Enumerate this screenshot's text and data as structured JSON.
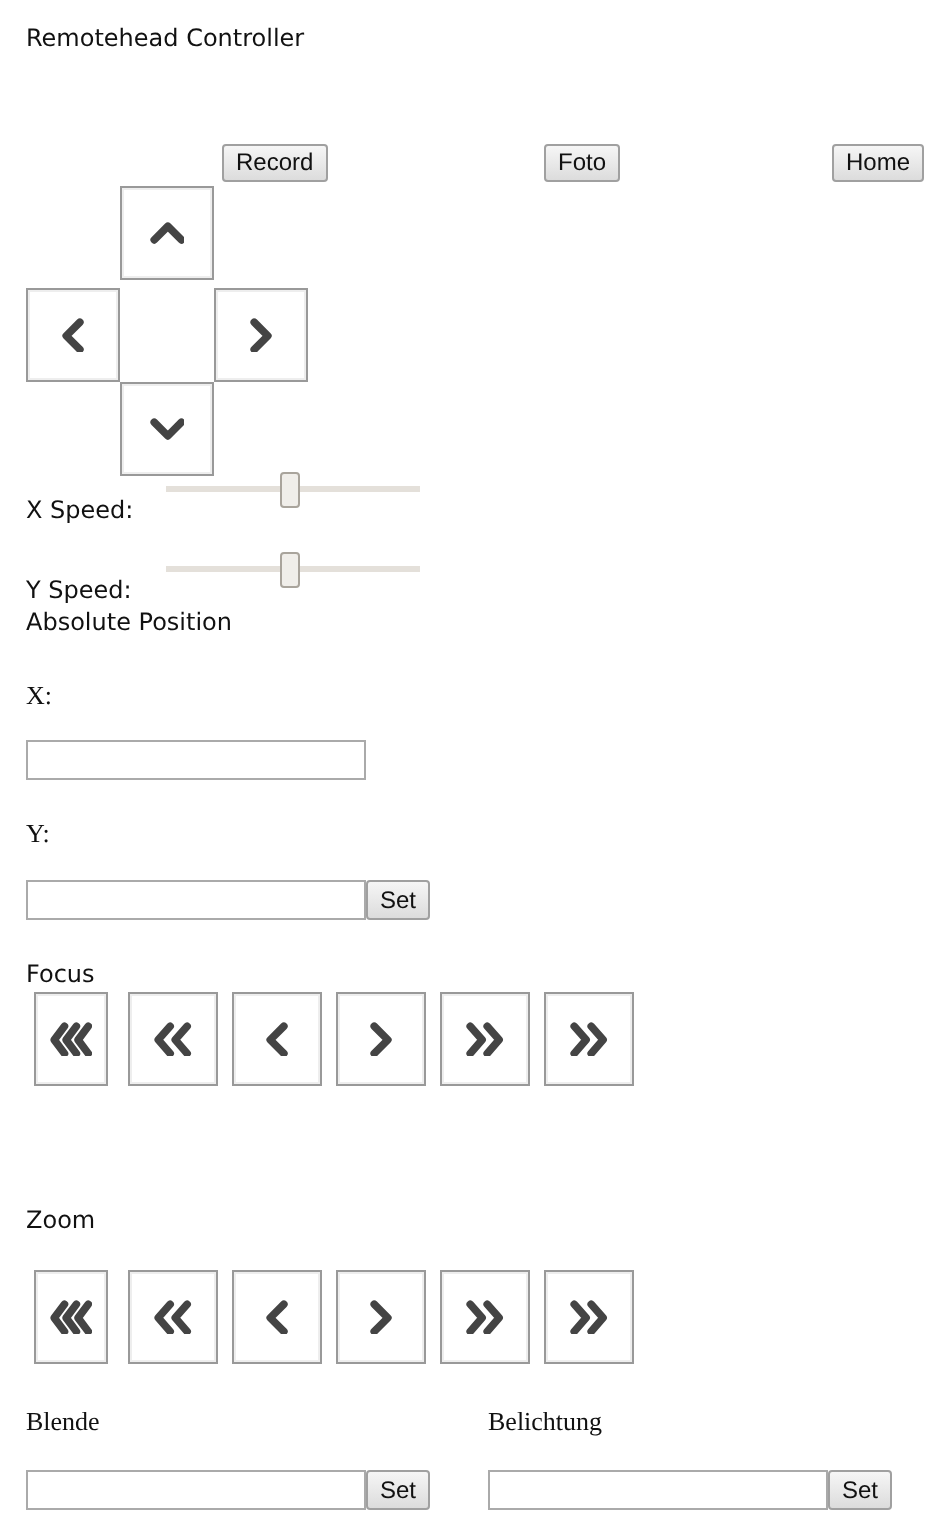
{
  "title": "Remotehead Controller",
  "top_buttons": [
    {
      "label": "Record"
    },
    {
      "label": "Foto"
    },
    {
      "label": "Home"
    }
  ],
  "dpad": [
    {
      "kind": "up"
    },
    {
      "kind": "left"
    },
    {
      "kind": "right"
    },
    {
      "kind": "down"
    }
  ],
  "speeds": [
    {
      "label": "X Speed:",
      "level": 0.49
    },
    {
      "label": "Y Speed:",
      "level": 0.49
    }
  ],
  "absolute_position": {
    "heading": "Absolute Position",
    "x_label": "X:",
    "y_label": "Y:",
    "set_button": "Set"
  },
  "focus": {
    "heading": "Focus",
    "buttons": [
      {
        "kind": "triple-left"
      },
      {
        "kind": "double-left"
      },
      {
        "kind": "left"
      },
      {
        "kind": "right"
      },
      {
        "kind": "double-right"
      },
      {
        "kind": "double-right"
      }
    ]
  },
  "zoom": {
    "heading": "Zoom",
    "buttons": [
      {
        "kind": "triple-left"
      },
      {
        "kind": "double-left"
      },
      {
        "kind": "left"
      },
      {
        "kind": "right"
      },
      {
        "kind": "double-right"
      },
      {
        "kind": "double-right"
      }
    ]
  },
  "settings": [
    {
      "label": "Blende",
      "set_button": "Set"
    },
    {
      "label": "Belichtung",
      "set_button": "Set"
    }
  ]
}
